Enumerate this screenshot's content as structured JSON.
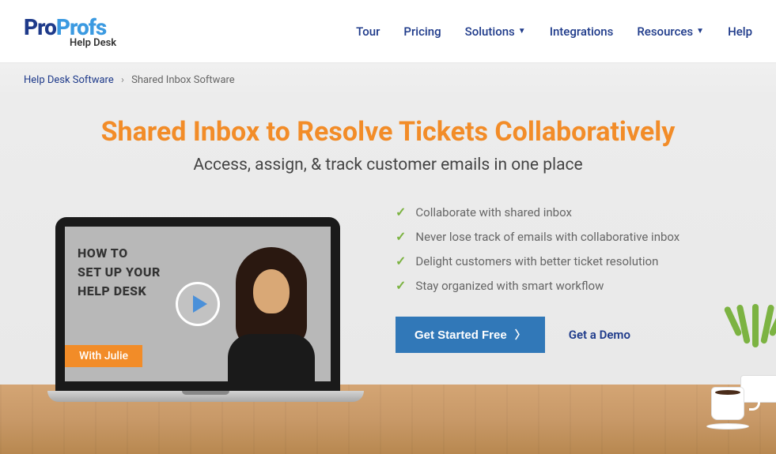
{
  "logo": {
    "pro": "Pro",
    "profs": "Profs",
    "sub": "Help Desk"
  },
  "nav": {
    "tour": "Tour",
    "pricing": "Pricing",
    "solutions": "Solutions",
    "integrations": "Integrations",
    "resources": "Resources",
    "help": "Help"
  },
  "breadcrumb": {
    "parent": "Help Desk Software",
    "current": "Shared Inbox Software"
  },
  "hero": {
    "title": "Shared Inbox to Resolve Tickets Collaboratively",
    "subtitle": "Access, assign, & track customer emails in one place"
  },
  "video": {
    "line1": "HOW TO",
    "line2": "SET UP YOUR",
    "line3": "HELP DESK",
    "badge": "With Julie"
  },
  "features": [
    "Collaborate with shared inbox",
    "Never lose track of emails with collaborative inbox",
    "Delight customers with better ticket resolution",
    "Stay organized with smart workflow"
  ],
  "cta": {
    "primary": "Get Started Free",
    "demo": "Get a Demo"
  }
}
